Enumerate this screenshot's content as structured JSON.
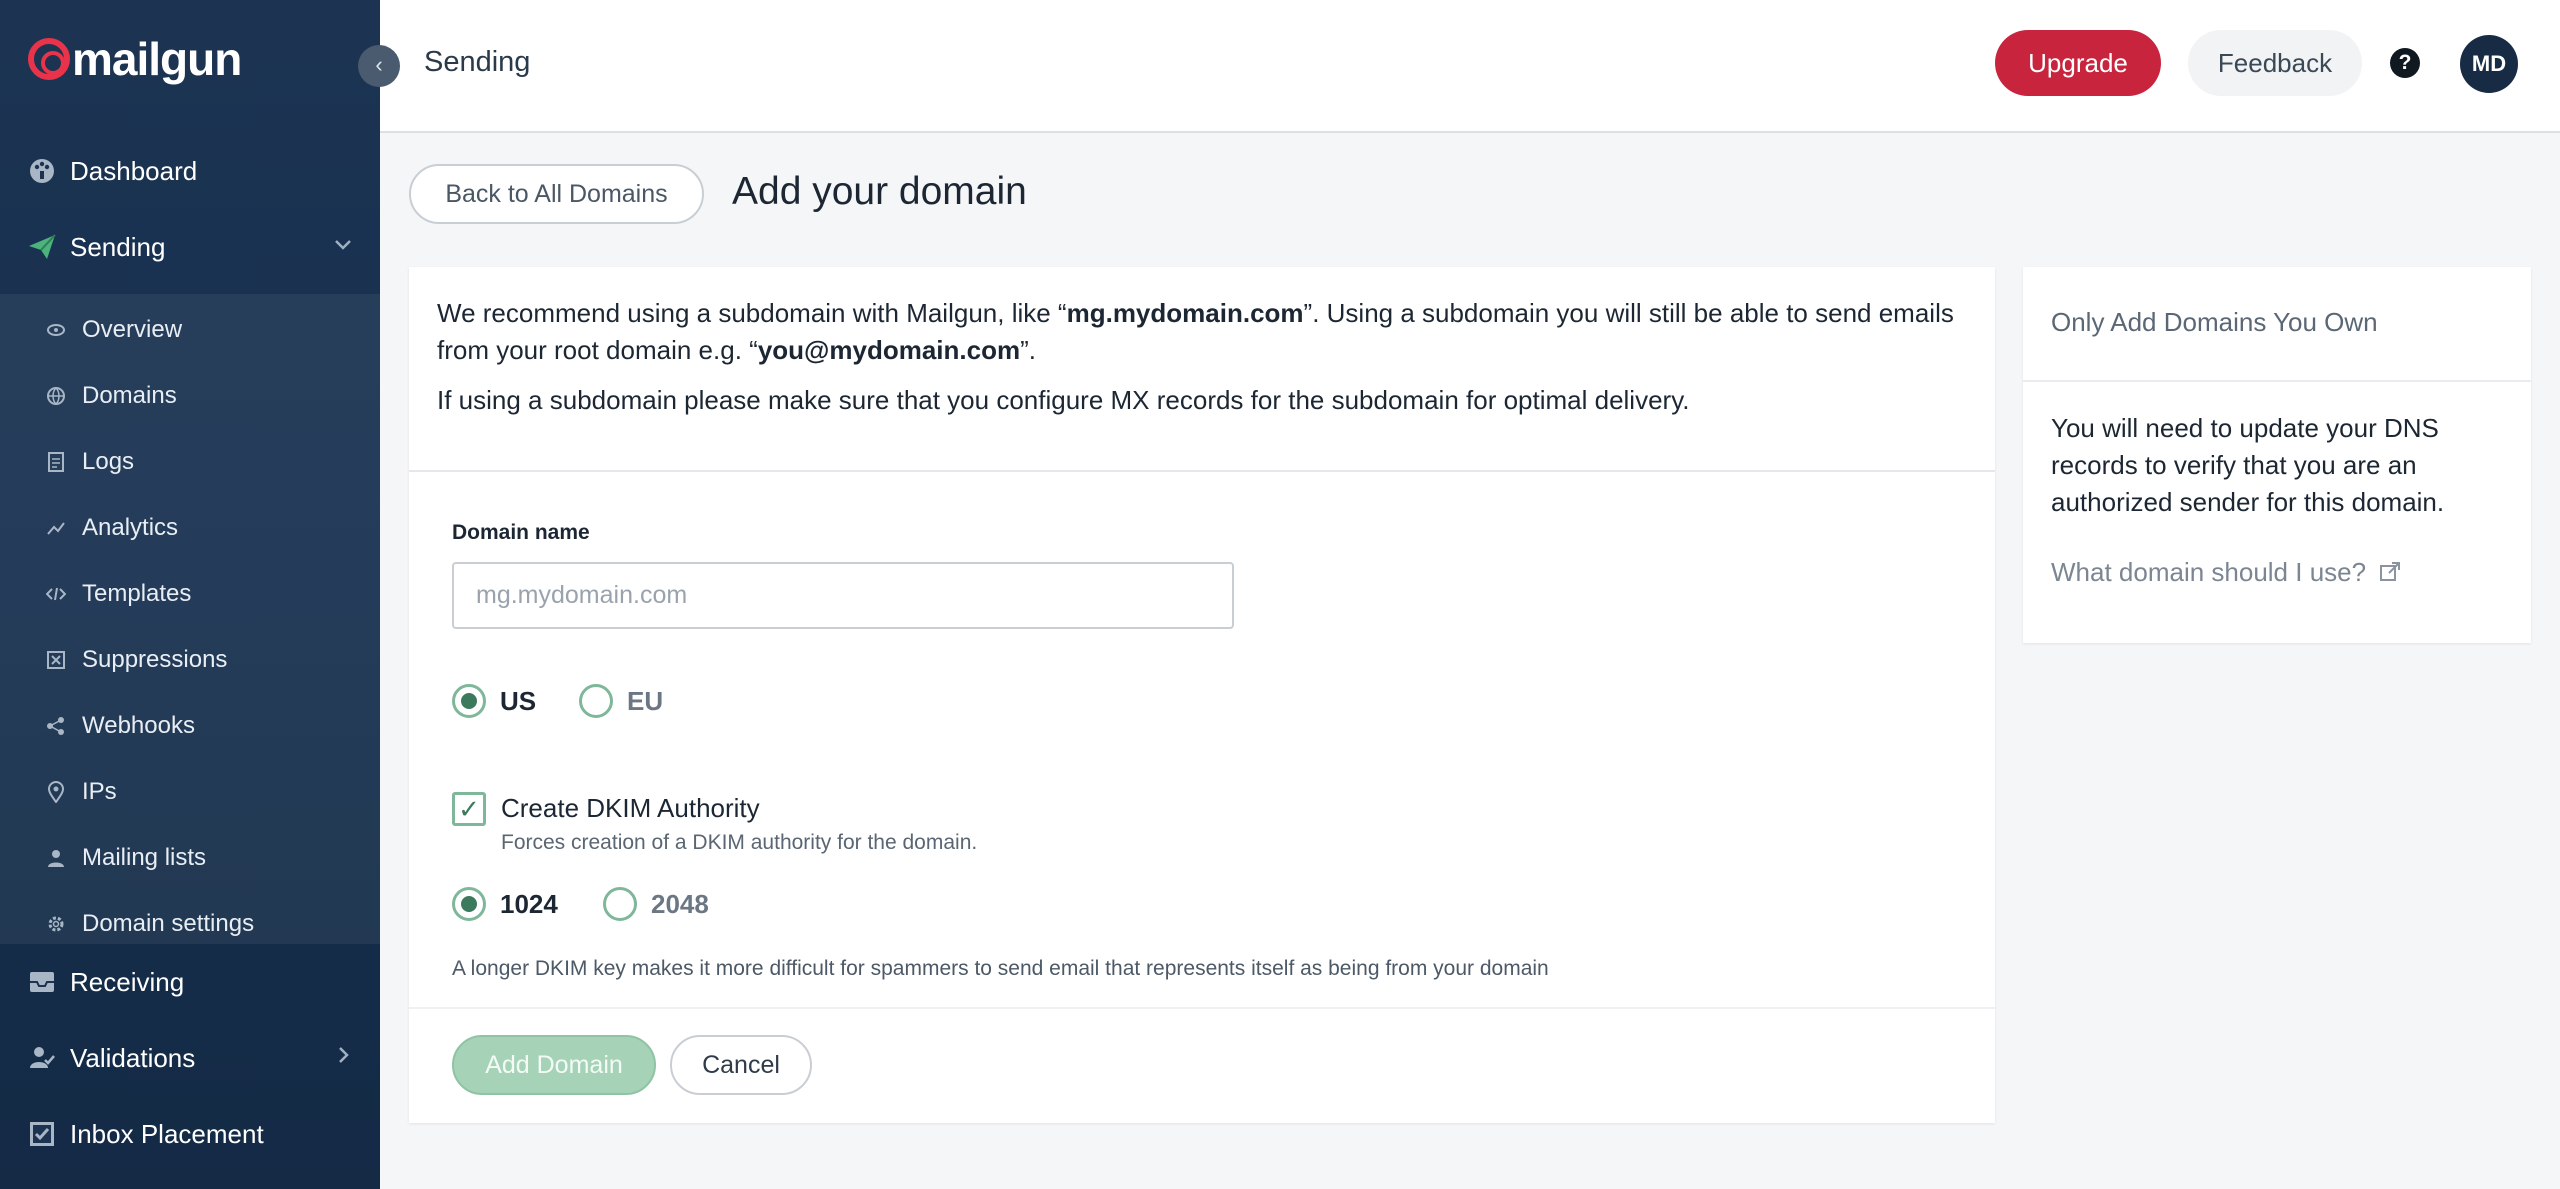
{
  "brand": {
    "name": "mailgun"
  },
  "sidebar": {
    "collapse": "‹",
    "main_items": [
      {
        "label": "Dashboard",
        "icon": "dashboard-icon"
      },
      {
        "label": "Sending",
        "icon": "paper-plane-icon"
      },
      {
        "label": "Receiving",
        "icon": "inbox-icon"
      },
      {
        "label": "Validations",
        "icon": "user-check-icon"
      },
      {
        "label": "Inbox Placement",
        "icon": "checkbox-icon"
      }
    ],
    "sending_items": [
      {
        "label": "Overview",
        "icon": "eye-icon"
      },
      {
        "label": "Domains",
        "icon": "globe-icon"
      },
      {
        "label": "Logs",
        "icon": "document-icon"
      },
      {
        "label": "Analytics",
        "icon": "trend-icon"
      },
      {
        "label": "Templates",
        "icon": "code-icon"
      },
      {
        "label": "Suppressions",
        "icon": "blocked-icon"
      },
      {
        "label": "Webhooks",
        "icon": "share-icon"
      },
      {
        "label": "IPs",
        "icon": "location-pin-icon"
      },
      {
        "label": "Mailing lists",
        "icon": "person-icon"
      },
      {
        "label": "Domain settings",
        "icon": "gear-icon"
      }
    ]
  },
  "header": {
    "title": "Sending",
    "upgrade_label": "Upgrade",
    "feedback_label": "Feedback",
    "help_label": "?",
    "avatar_initials": "MD"
  },
  "page": {
    "back_label": "Back to All Domains",
    "title": "Add your domain"
  },
  "form": {
    "intro_a": "We recommend using a subdomain with Mailgun, like “",
    "intro_b": "mg.mydomain.com",
    "intro_c": "”. Using a subdomain you will still be able to send emails from your root domain e.g. “",
    "intro_d": "you@mydomain.com",
    "intro_e": "”.",
    "intro2": "If using a subdomain please make sure that you configure MX records for the subdomain for optimal delivery.",
    "domain_label": "Domain name",
    "domain_placeholder": "mg.mydomain.com",
    "domain_value": "",
    "region_options": [
      "US",
      "EU"
    ],
    "region_selected": "US",
    "dkim_checkbox_label": "Create DKIM Authority",
    "dkim_checkbox_sub": "Forces creation of a DKIM authority for the domain.",
    "dkim_checked": true,
    "dkim_key_options": [
      "1024",
      "2048"
    ],
    "dkim_key_selected": "1024",
    "dkim_note": "A longer DKIM key makes it more difficult for spammers to send email that represents itself as being from your domain",
    "add_label": "Add Domain",
    "cancel_label": "Cancel"
  },
  "side_panel": {
    "heading": "Only Add Domains You Own",
    "body": "You will need to update your DNS records to verify that you are an authorized sender for this domain.",
    "link_label": "What domain should I use?",
    "link_icon": "external-link-icon"
  },
  "colors": {
    "sidebar_bg": "#1c3452",
    "brand_red": "#e8334a",
    "upgrade": "#c8243d",
    "accent_green": "#3c7a5d"
  }
}
